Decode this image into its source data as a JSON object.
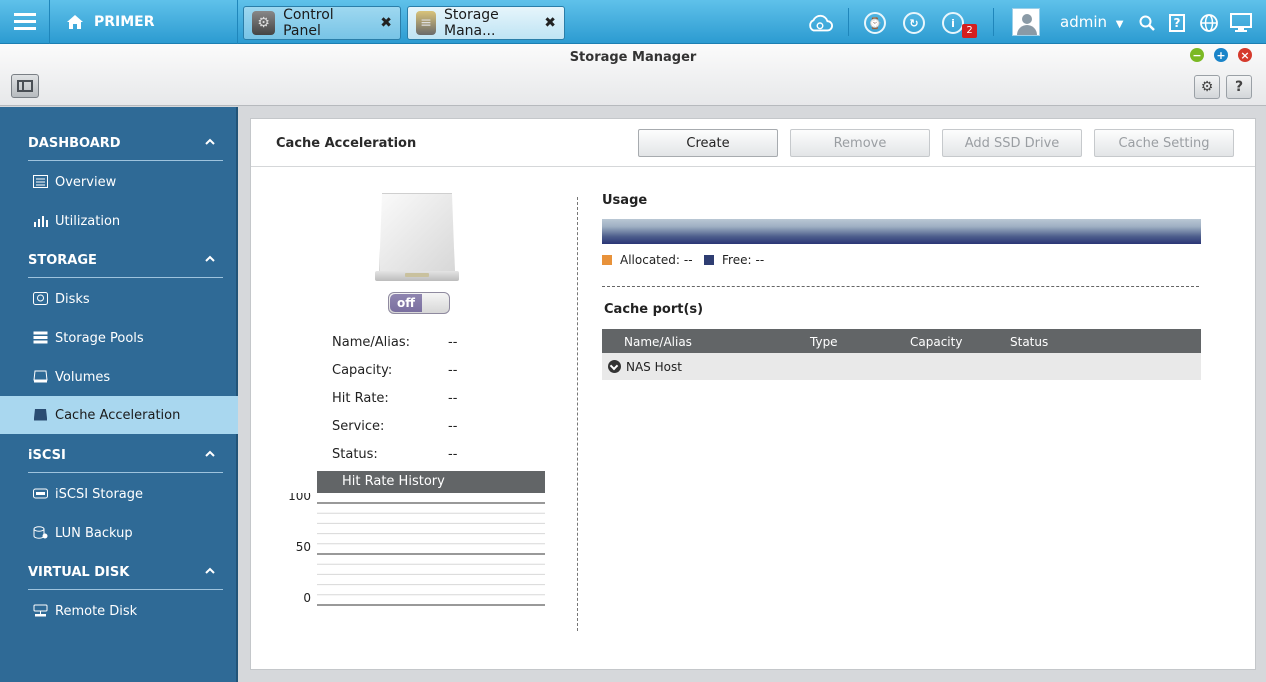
{
  "topbar": {
    "home_label": "PRIMER",
    "tabs": [
      {
        "label": "Control Panel",
        "close": "✖"
      },
      {
        "label": "Storage Mana...",
        "close": "✖"
      }
    ],
    "notification_count": "2",
    "user": "admin"
  },
  "window": {
    "title": "Storage Manager"
  },
  "sidebar": {
    "sections": [
      {
        "label": "DASHBOARD"
      },
      {
        "label": "STORAGE"
      },
      {
        "label": "iSCSI"
      },
      {
        "label": "VIRTUAL DISK"
      }
    ],
    "items": [
      {
        "label": "Overview"
      },
      {
        "label": "Utilization"
      },
      {
        "label": "Disks"
      },
      {
        "label": "Storage Pools"
      },
      {
        "label": "Volumes"
      },
      {
        "label": "Cache Acceleration",
        "active": true
      },
      {
        "label": "iSCSI Storage"
      },
      {
        "label": "LUN Backup"
      },
      {
        "label": "Remote Disk"
      }
    ]
  },
  "panel": {
    "title": "Cache Acceleration",
    "buttons": {
      "create": "Create",
      "remove": "Remove",
      "add_ssd": "Add SSD Drive",
      "cache_setting": "Cache Setting"
    },
    "toggle_label": "off",
    "info": [
      {
        "key": "Name/Alias:",
        "value": "--"
      },
      {
        "key": "Capacity:",
        "value": "--"
      },
      {
        "key": "Hit Rate:",
        "value": "--"
      },
      {
        "key": "Service:",
        "value": "--"
      },
      {
        "key": "Status:",
        "value": "--"
      }
    ],
    "hit_rate_title": "Hit Rate History",
    "usage": {
      "title": "Usage",
      "allocated_label": "Allocated:",
      "allocated_value": "--",
      "free_label": "Free:",
      "free_value": "--",
      "allocated_color": "#e8923a",
      "free_color": "#2f3d72"
    },
    "cache_ports": {
      "title": "Cache port(s)",
      "columns": [
        "Name/Alias",
        "Type",
        "Capacity",
        "Status"
      ],
      "rows": [
        {
          "name": "NAS Host"
        }
      ]
    }
  },
  "chart_data": {
    "type": "line",
    "title": "Hit Rate History",
    "yticks": [
      "100",
      "50",
      "0"
    ],
    "ylim": [
      0,
      100
    ],
    "series": []
  }
}
